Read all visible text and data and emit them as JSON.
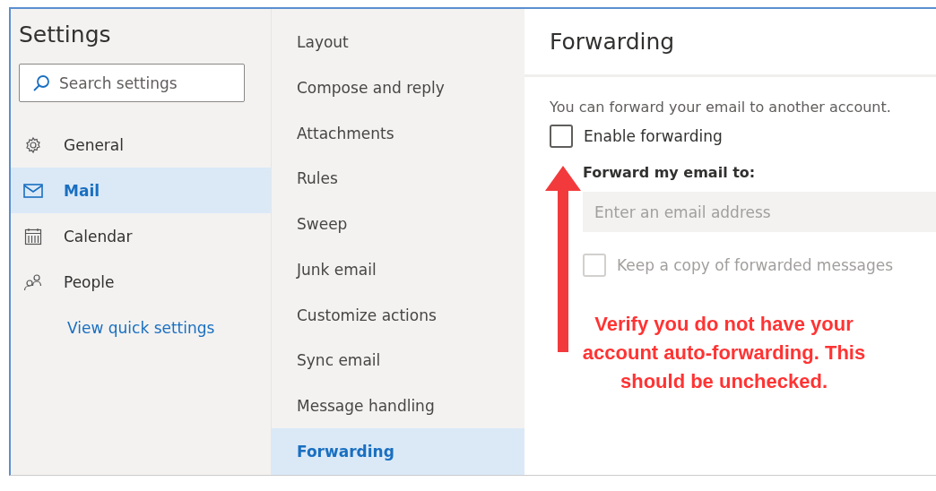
{
  "settings": {
    "title": "Settings",
    "search": {
      "placeholder": "Search settings"
    },
    "items": [
      {
        "kind": "gear",
        "label": "General",
        "selected": false
      },
      {
        "kind": "mail",
        "label": "Mail",
        "selected": true
      },
      {
        "kind": "calendar",
        "label": "Calendar",
        "selected": false
      },
      {
        "kind": "people",
        "label": "People",
        "selected": false
      }
    ],
    "link": "View quick settings"
  },
  "categories": [
    {
      "label": "Layout",
      "selected": false
    },
    {
      "label": "Compose and reply",
      "selected": false
    },
    {
      "label": "Attachments",
      "selected": false
    },
    {
      "label": "Rules",
      "selected": false
    },
    {
      "label": "Sweep",
      "selected": false
    },
    {
      "label": "Junk email",
      "selected": false
    },
    {
      "label": "Customize actions",
      "selected": false
    },
    {
      "label": "Sync email",
      "selected": false
    },
    {
      "label": "Message handling",
      "selected": false
    },
    {
      "label": "Forwarding",
      "selected": true
    }
  ],
  "forwarding": {
    "title": "Forwarding",
    "description": "You can forward your email to another account.",
    "enable": {
      "label": "Enable forwarding",
      "checked": false
    },
    "forward_to_label": "Forward my email to:",
    "address": {
      "placeholder": "Enter an email address",
      "disabled": true
    },
    "keep_copy": {
      "label": "Keep a copy of forwarded messages",
      "checked": false,
      "disabled": true
    }
  },
  "annotation": {
    "text": "Verify you do not have your account auto-forwarding. This should be unchecked."
  }
}
